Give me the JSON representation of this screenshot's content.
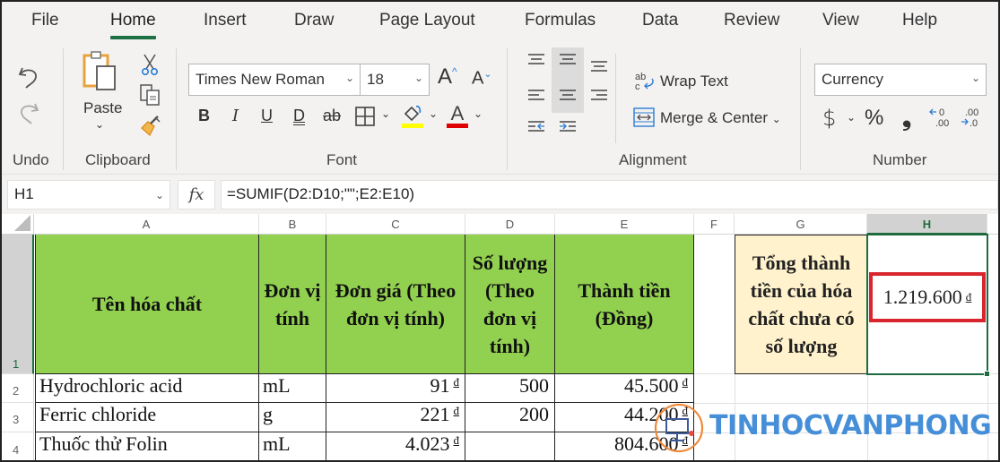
{
  "menu": {
    "tabs": [
      {
        "label": "File",
        "active": false
      },
      {
        "label": "Home",
        "active": true
      },
      {
        "label": "Insert",
        "active": false
      },
      {
        "label": "Draw",
        "active": false
      },
      {
        "label": "Page Layout",
        "active": false
      },
      {
        "label": "Formulas",
        "active": false
      },
      {
        "label": "Data",
        "active": false
      },
      {
        "label": "Review",
        "active": false
      },
      {
        "label": "View",
        "active": false
      },
      {
        "label": "Help",
        "active": false
      }
    ]
  },
  "ribbon": {
    "groups": {
      "undo": "Undo",
      "clipboard": "Clipboard",
      "font": "Font",
      "alignment": "Alignment",
      "number": "Number"
    },
    "paste_label": "Paste",
    "font_name": "Times New Roman",
    "font_size": "18",
    "wrap_text_label": "Wrap Text",
    "merge_center_label": "Merge & Center",
    "number_format": "Currency",
    "icons": {
      "undo": "undo-icon",
      "redo": "redo-icon",
      "cut": "scissors-icon",
      "copy": "copy-icon",
      "format_painter": "brush-icon",
      "bold": "B",
      "italic": "I",
      "underline": "U",
      "double_underline": "D",
      "strikethrough": "ab",
      "grow_font": "A",
      "shrink_font": "A",
      "font_color": "A",
      "currency": "$",
      "percent": "%",
      "comma": "❟",
      "increase_decimal": "←0 .00",
      "decrease_decimal": ".00 →0"
    },
    "colors": {
      "fill_highlight": "#ffff00",
      "font_color": "#e00000",
      "accent": "#1e7145"
    }
  },
  "formula_bar": {
    "name_box": "H1",
    "fx_label": "fx",
    "formula": "=SUMIF(D2:D10;\"\";E2:E10)"
  },
  "sheet": {
    "columns": [
      "A",
      "B",
      "C",
      "D",
      "E",
      "F",
      "G",
      "H"
    ],
    "selected_column": "H",
    "rows": [
      "1",
      "2",
      "3",
      "4"
    ],
    "header": {
      "a": "Tên hóa chất",
      "b": "Đơn vị tính",
      "c": "Đơn giá (Theo đơn vị tính)",
      "d": "Số lượng (Theo đơn vị tính)",
      "e": "Thành tiền (Đồng)"
    },
    "data_rows": [
      {
        "name": "Hydrochloric acid",
        "unit": "mL",
        "price": "91",
        "qty": "500",
        "total": "45.500"
      },
      {
        "name": "Ferric chloride",
        "unit": "g",
        "price": "221",
        "qty": "200",
        "total": "44.200"
      },
      {
        "name": "Thuốc thử Folin",
        "unit": "mL",
        "price": "4.023",
        "qty": "",
        "total": "804.600"
      }
    ],
    "currency_symbol": "đ",
    "summary_label": "Tổng thành tiền của hóa chất chưa có số lượng",
    "summary_value": "1.219.600",
    "colors": {
      "header_fill": "#92d050",
      "summary_fill": "#fff2cc",
      "highlight_border": "#d9262e"
    }
  },
  "watermark": {
    "text": "TINHOCVANPHONG",
    "color": "#3d8ad6"
  }
}
